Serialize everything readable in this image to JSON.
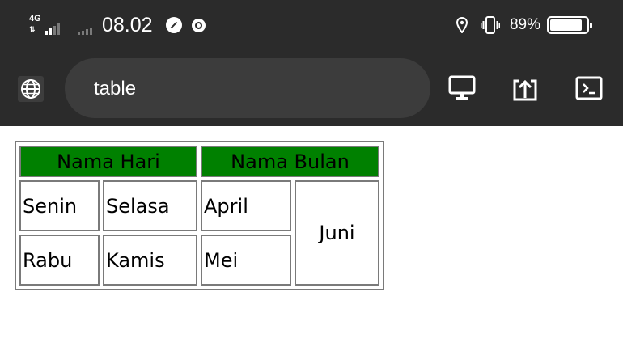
{
  "status_bar": {
    "network": "4G",
    "time": "08.02",
    "battery_percent": "89%",
    "battery_level": 0.89,
    "icons": [
      "signal-4g-icon",
      "signal-bars-icon",
      "compass-icon",
      "chrome-icon",
      "location-pin-icon",
      "vibrate-icon",
      "battery-icon"
    ]
  },
  "toolbar": {
    "url_text": "table",
    "icons": [
      "globe-icon",
      "desktop-icon",
      "share-upload-icon",
      "console-icon"
    ]
  },
  "table": {
    "header_color": "#008000",
    "headers": [
      "Nama Hari",
      "Nama Bulan"
    ],
    "rows": [
      [
        "Senin",
        "Selasa",
        "April"
      ],
      [
        "Rabu",
        "Kamis",
        "Mei"
      ]
    ],
    "merged_cell": "Juni"
  }
}
